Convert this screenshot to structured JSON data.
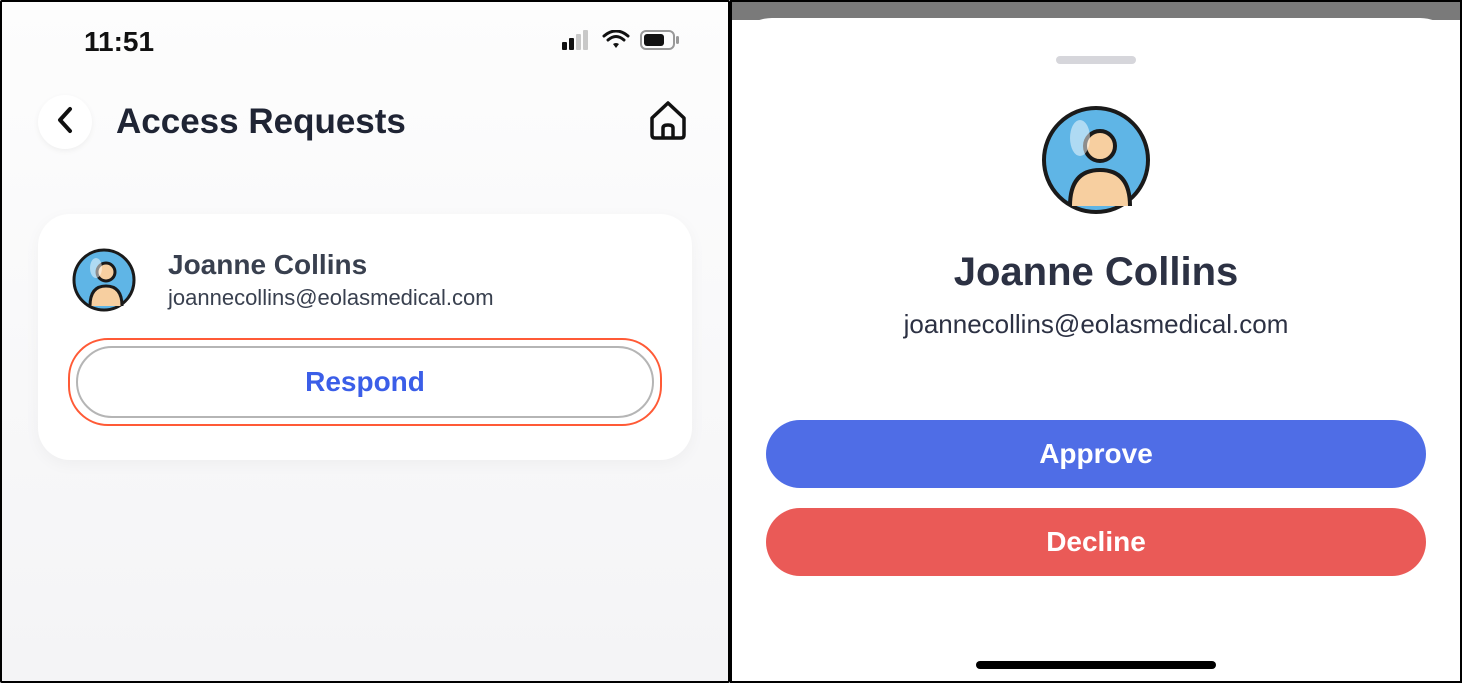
{
  "statusBar": {
    "time": "11:51"
  },
  "header": {
    "title": "Access Requests"
  },
  "request": {
    "name": "Joanne Collins",
    "email": "joannecollins@eolasmedical.com",
    "respondLabel": "Respond"
  },
  "sheet": {
    "name": "Joanne Collins",
    "email": "joannecollins@eolasmedical.com",
    "approveLabel": "Approve",
    "declineLabel": "Decline"
  }
}
